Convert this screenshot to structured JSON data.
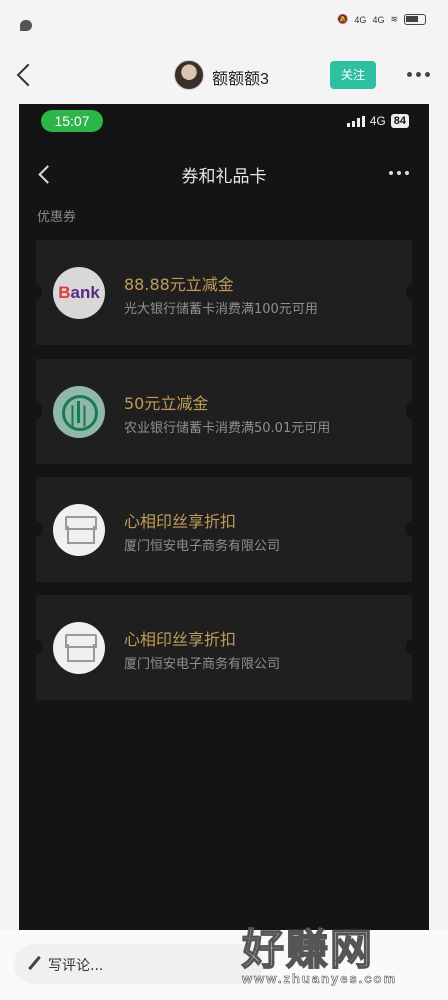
{
  "outer": {
    "status": {
      "net1": "4G",
      "net2": "4G"
    },
    "header": {
      "username": "额额额3",
      "follow_label": "关注"
    }
  },
  "inner": {
    "status": {
      "time": "15:07",
      "network": "4G",
      "battery": "84"
    },
    "title": "券和礼品卡",
    "section_label": "优惠券",
    "coupons": [
      {
        "icon": "bank-logo-icon",
        "title": "88.88元立减金",
        "subtitle": "光大银行储蓄卡消费满100元可用"
      },
      {
        "icon": "abc-bank-logo-icon",
        "title": "50元立减金",
        "subtitle": "农业银行储蓄卡消费满50.01元可用"
      },
      {
        "icon": "shop-icon",
        "title": "心相印丝享折扣",
        "subtitle": "厦门恒安电子商务有限公司"
      },
      {
        "icon": "shop-icon",
        "title": "心相印丝享折扣",
        "subtitle": "厦门恒安电子商务有限公司"
      }
    ],
    "bank_logo_text": {
      "b": "B",
      "ank": "ank"
    }
  },
  "bottom": {
    "comment_placeholder": "写评论...",
    "watermark_big": "好赚网",
    "watermark_small": "www.zhuanyes.com"
  },
  "colors": {
    "accent": "#2ec0a0",
    "time_pill": "#2db54a",
    "coupon_title": "#c29b57",
    "inner_bg": "#141414",
    "card_bg": "#1f1f1f"
  }
}
